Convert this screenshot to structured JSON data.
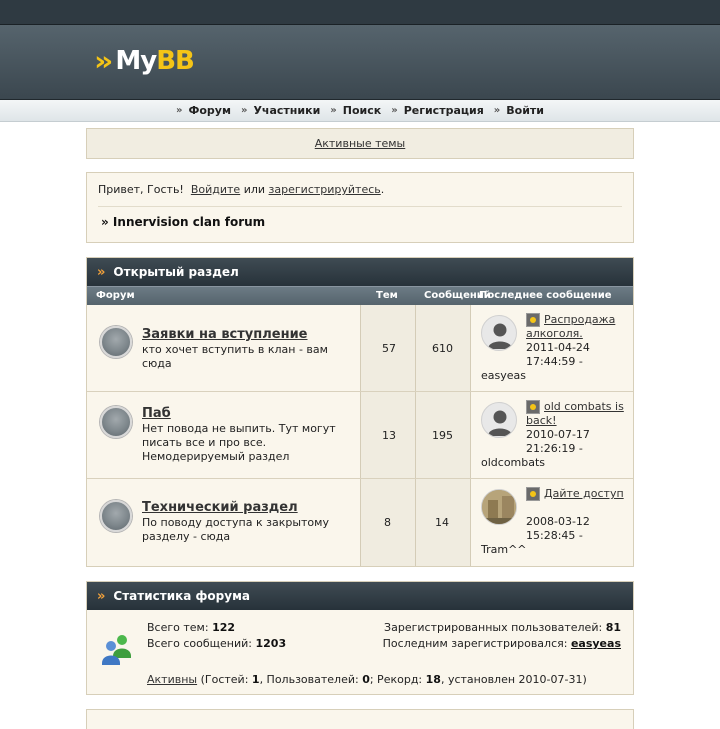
{
  "brand": {
    "logo_text_my": "My",
    "logo_text_bb": "BB"
  },
  "menu": [
    {
      "label": "Форум"
    },
    {
      "label": "Участники"
    },
    {
      "label": "Поиск"
    },
    {
      "label": "Регистрация"
    },
    {
      "label": "Войти"
    }
  ],
  "active_topics": "Активные темы",
  "welcome": {
    "greeting": "Привет, Гость!",
    "login": "Войдите",
    "or": "или",
    "register": "зарегистрируйтесь",
    "end": ".",
    "board": "» Innervision clan forum"
  },
  "category": {
    "title": "Открытый раздел",
    "columns": {
      "forum": "Форум",
      "topics": "Тем",
      "posts": "Сообщений",
      "last_post": "Последнее сообщение"
    },
    "forums": [
      {
        "title": "Заявки на вступление",
        "desc": "кто хочет вступить в клан - вам сюда",
        "topics": "57",
        "posts": "610",
        "last_title": "Распродажа алкоголя.",
        "last_date": "2011-04-24 17:44:59 -",
        "last_user": "easyeas",
        "avatar": "default-user"
      },
      {
        "title": "Паб",
        "desc": "Нет повода не выпить. Тут могут писать все и про все. Немодерируемый раздел",
        "topics": "13",
        "posts": "195",
        "last_title": "old combats is back!",
        "last_date": "2010-07-17 21:26:19 -",
        "last_user": "oldcombats",
        "avatar": "default-user"
      },
      {
        "title": "Технический раздел",
        "desc": "По поводу доступа к закрытому разделу - сюда",
        "topics": "8",
        "posts": "14",
        "last_title": "Дайте доступ",
        "last_date": "2008-03-12 15:28:45 -",
        "last_user": "Tram^^",
        "avatar": "photo-user"
      }
    ]
  },
  "stats": {
    "title": "Статистика форума",
    "topics_label": "Всего тем:",
    "topics": "122",
    "posts_label": "Всего сообщений:",
    "posts": "1203",
    "registered_label": "Зарегистрированных пользователей:",
    "registered": "81",
    "last_reg_label": "Последним зарегистрировался:",
    "last_reg": "easyeas",
    "online_link": "Активны",
    "online_text_1": " (Гостей: ",
    "guests": "1",
    "online_text_2": ", Пользователей: ",
    "users": "0",
    "online_text_3": "; Рекорд: ",
    "record": "18",
    "online_text_4": ", установлен 2010-07-31)"
  },
  "colors": {
    "accent": "#f4c417",
    "header": "#3b474f",
    "panel": "#faf6ec"
  }
}
